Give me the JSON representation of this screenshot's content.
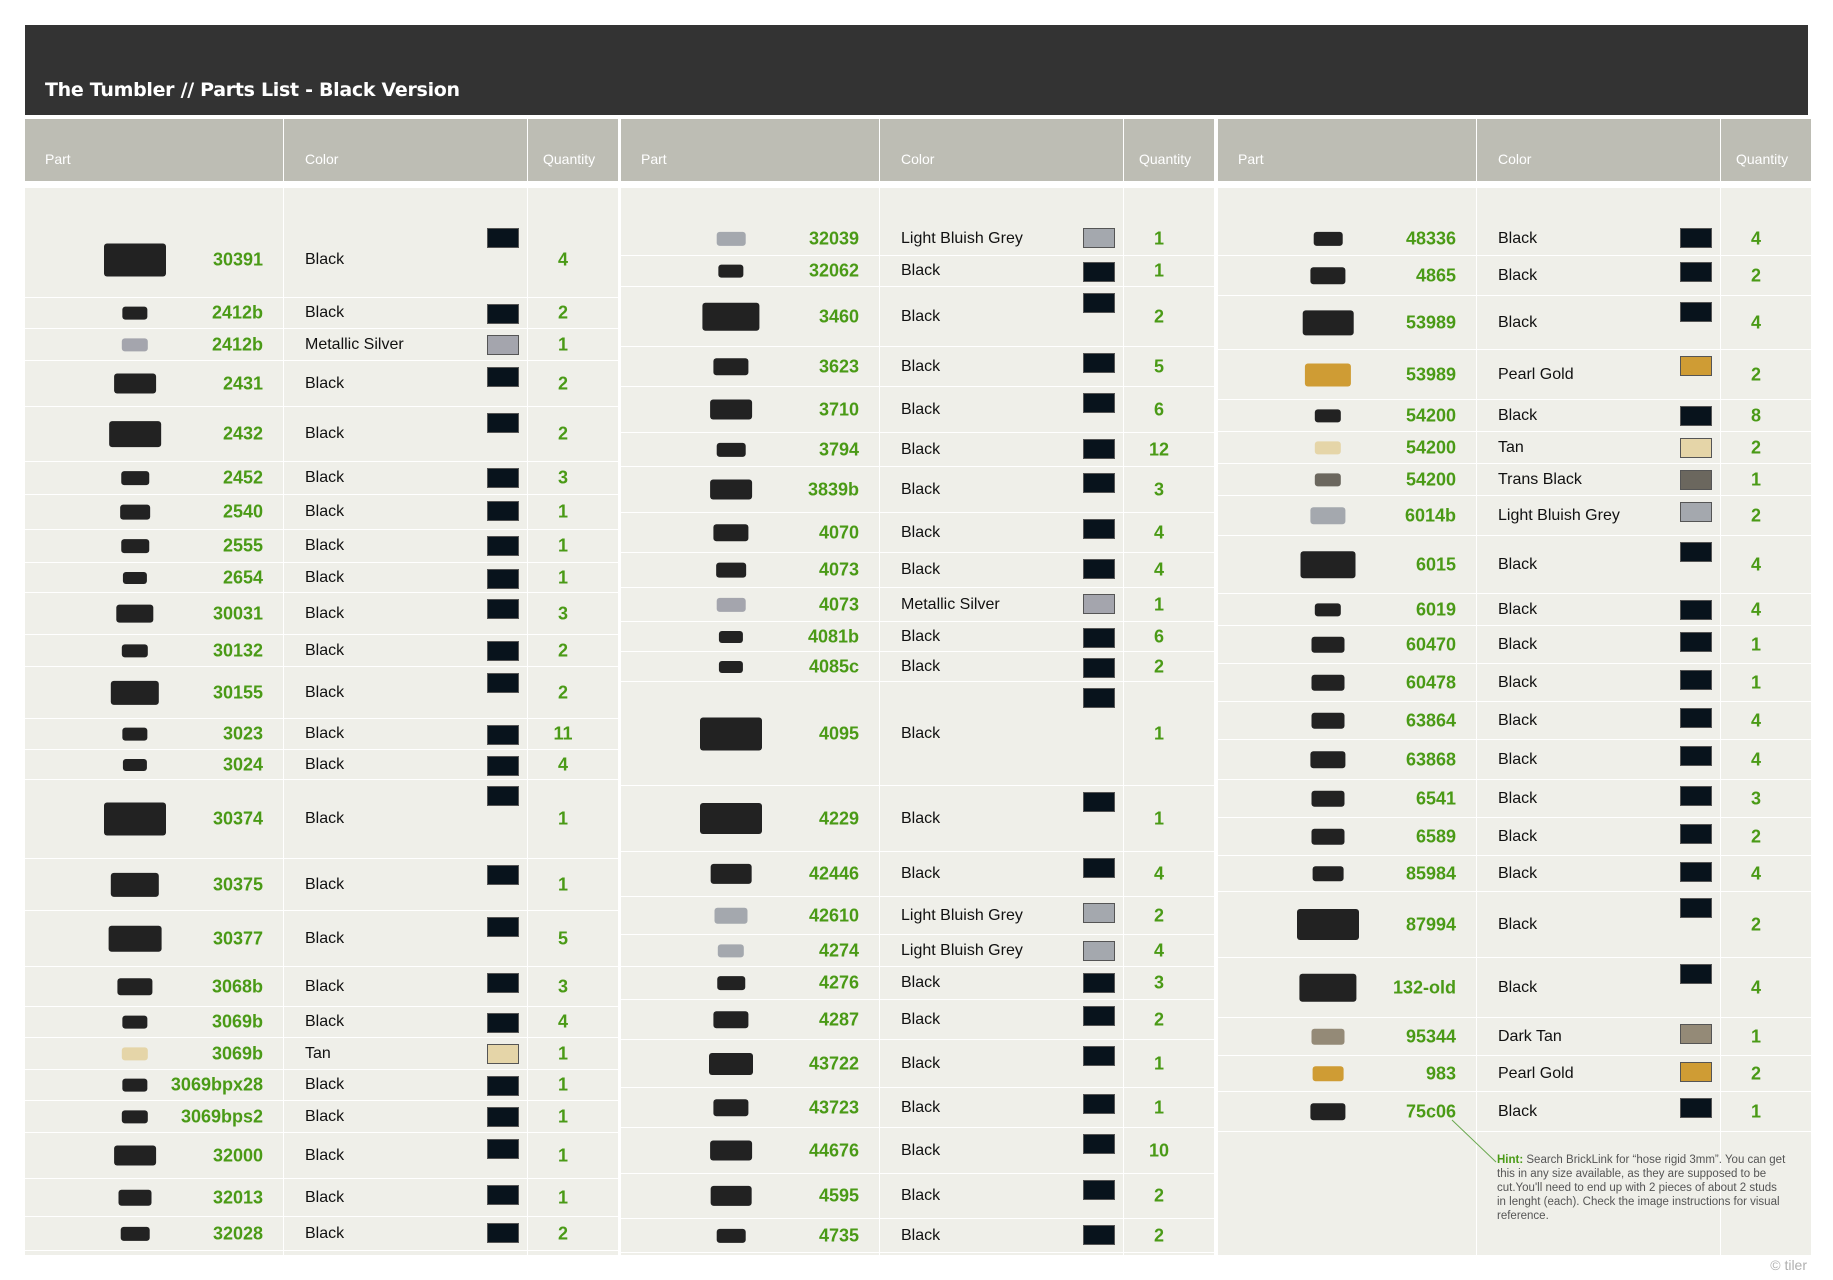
{
  "title": "The Tumbler // Parts List - Black Version",
  "headers": {
    "part": "Part",
    "color": "Color",
    "quantity": "Quantity"
  },
  "colors": {
    "Black": "#08131c",
    "Metallic Silver": "#a4a5ad",
    "Light Bluish Grey": "#a4a8ae",
    "Tan": "#e5d5a8",
    "Pearl Gold": "#cf9c34",
    "Trans Black": "#6b675e",
    "Dark Tan": "#948a77"
  },
  "columns": [
    {
      "rows": [
        {
          "part": "30391",
          "color": "Black",
          "qty": "4",
          "h": 76
        },
        {
          "part": "2412b",
          "color": "Black",
          "qty": "2",
          "h": 31
        },
        {
          "part": "2412b",
          "color": "Metallic Silver",
          "qty": "1",
          "h": 32
        },
        {
          "part": "2431",
          "color": "Black",
          "qty": "2",
          "h": 46
        },
        {
          "part": "2432",
          "color": "Black",
          "qty": "2",
          "h": 55
        },
        {
          "part": "2452",
          "color": "Black",
          "qty": "3",
          "h": 33
        },
        {
          "part": "2540",
          "color": "Black",
          "qty": "1",
          "h": 35
        },
        {
          "part": "2555",
          "color": "Black",
          "qty": "1",
          "h": 33
        },
        {
          "part": "2654",
          "color": "Black",
          "qty": "1",
          "h": 30
        },
        {
          "part": "30031",
          "color": "Black",
          "qty": "3",
          "h": 42
        },
        {
          "part": "30132",
          "color": "Black",
          "qty": "2",
          "h": 32
        },
        {
          "part": "30155",
          "color": "Black",
          "qty": "2",
          "h": 52
        },
        {
          "part": "3023",
          "color": "Black",
          "qty": "11",
          "h": 31
        },
        {
          "part": "3024",
          "color": "Black",
          "qty": "4",
          "h": 30
        },
        {
          "part": "30374",
          "color": "Black",
          "qty": "1",
          "h": 79
        },
        {
          "part": "30375",
          "color": "Black",
          "qty": "1",
          "h": 52
        },
        {
          "part": "30377",
          "color": "Black",
          "qty": "5",
          "h": 56
        },
        {
          "part": "3068b",
          "color": "Black",
          "qty": "3",
          "h": 40
        },
        {
          "part": "3069b",
          "color": "Black",
          "qty": "4",
          "h": 31
        },
        {
          "part": "3069b",
          "color": "Tan",
          "qty": "1",
          "h": 32
        },
        {
          "part": "3069bpx28",
          "color": "Black",
          "qty": "1",
          "h": 31
        },
        {
          "part": "3069bps2",
          "color": "Black",
          "qty": "1",
          "h": 32
        },
        {
          "part": "32000",
          "color": "Black",
          "qty": "1",
          "h": 46
        },
        {
          "part": "32013",
          "color": "Black",
          "qty": "1",
          "h": 38
        },
        {
          "part": "32028",
          "color": "Black",
          "qty": "2",
          "h": 34
        }
      ]
    },
    {
      "rows": [
        {
          "part": "32039",
          "color": "Light Bluish Grey",
          "qty": "1",
          "h": 34
        },
        {
          "part": "32062",
          "color": "Black",
          "qty": "1",
          "h": 31
        },
        {
          "part": "3460",
          "color": "Black",
          "qty": "2",
          "h": 60
        },
        {
          "part": "3623",
          "color": "Black",
          "qty": "5",
          "h": 40
        },
        {
          "part": "3710",
          "color": "Black",
          "qty": "6",
          "h": 46
        },
        {
          "part": "3794",
          "color": "Black",
          "qty": "12",
          "h": 34
        },
        {
          "part": "3839b",
          "color": "Black",
          "qty": "3",
          "h": 46
        },
        {
          "part": "4070",
          "color": "Black",
          "qty": "4",
          "h": 40
        },
        {
          "part": "4073",
          "color": "Black",
          "qty": "4",
          "h": 35
        },
        {
          "part": "4073",
          "color": "Metallic Silver",
          "qty": "1",
          "h": 34
        },
        {
          "part": "4081b",
          "color": "Black",
          "qty": "6",
          "h": 30
        },
        {
          "part": "4085c",
          "color": "Black",
          "qty": "2",
          "h": 30
        },
        {
          "part": "4095",
          "color": "Black",
          "qty": "1",
          "h": 104
        },
        {
          "part": "4229",
          "color": "Black",
          "qty": "1",
          "h": 66
        },
        {
          "part": "42446",
          "color": "Black",
          "qty": "4",
          "h": 45
        },
        {
          "part": "42610",
          "color": "Light Bluish Grey",
          "qty": "2",
          "h": 38
        },
        {
          "part": "4274",
          "color": "Light Bluish Grey",
          "qty": "4",
          "h": 32
        },
        {
          "part": "4276",
          "color": "Black",
          "qty": "3",
          "h": 33
        },
        {
          "part": "4287",
          "color": "Black",
          "qty": "2",
          "h": 40
        },
        {
          "part": "43722",
          "color": "Black",
          "qty": "1",
          "h": 48
        },
        {
          "part": "43723",
          "color": "Black",
          "qty": "1",
          "h": 40
        },
        {
          "part": "44676",
          "color": "Black",
          "qty": "10",
          "h": 46
        },
        {
          "part": "4595",
          "color": "Black",
          "qty": "2",
          "h": 45
        },
        {
          "part": "4735",
          "color": "Black",
          "qty": "2",
          "h": 34
        }
      ]
    },
    {
      "rows": [
        {
          "part": "48336",
          "color": "Black",
          "qty": "4",
          "h": 34
        },
        {
          "part": "4865",
          "color": "Black",
          "qty": "2",
          "h": 40
        },
        {
          "part": "53989",
          "color": "Black",
          "qty": "4",
          "h": 54
        },
        {
          "part": "53989",
          "color": "Pearl Gold",
          "qty": "2",
          "h": 50
        },
        {
          "part": "54200",
          "color": "Black",
          "qty": "8",
          "h": 32
        },
        {
          "part": "54200",
          "color": "Tan",
          "qty": "2",
          "h": 32
        },
        {
          "part": "54200",
          "color": "Trans Black",
          "qty": "1",
          "h": 32
        },
        {
          "part": "6014b",
          "color": "Light Bluish Grey",
          "qty": "2",
          "h": 40
        },
        {
          "part": "6015",
          "color": "Black",
          "qty": "4",
          "h": 58
        },
        {
          "part": "6019",
          "color": "Black",
          "qty": "4",
          "h": 32
        },
        {
          "part": "60470",
          "color": "Black",
          "qty": "1",
          "h": 38
        },
        {
          "part": "60478",
          "color": "Black",
          "qty": "1",
          "h": 38
        },
        {
          "part": "63864",
          "color": "Black",
          "qty": "4",
          "h": 38
        },
        {
          "part": "63868",
          "color": "Black",
          "qty": "4",
          "h": 40
        },
        {
          "part": "6541",
          "color": "Black",
          "qty": "3",
          "h": 38
        },
        {
          "part": "6589",
          "color": "Black",
          "qty": "2",
          "h": 38
        },
        {
          "part": "85984",
          "color": "Black",
          "qty": "4",
          "h": 36
        },
        {
          "part": "87994",
          "color": "Black",
          "qty": "2",
          "h": 66
        },
        {
          "part": "132-old",
          "color": "Black",
          "qty": "4",
          "h": 60
        },
        {
          "part": "95344",
          "color": "Dark Tan",
          "qty": "1",
          "h": 38
        },
        {
          "part": "983",
          "color": "Pearl Gold",
          "qty": "2",
          "h": 36
        },
        {
          "part": "75c06",
          "color": "Black",
          "qty": "1",
          "h": 40
        }
      ]
    }
  ],
  "hint": {
    "label": "Hint:",
    "text": "Search BrickLink for “hose rigid 3mm”. You can get this in any size available, as they are supposed to be cut.You'll need to end up with 2 pieces of about 2 studs in lenght (each). Check the image instructions for visual reference."
  },
  "credit": "© tiler"
}
